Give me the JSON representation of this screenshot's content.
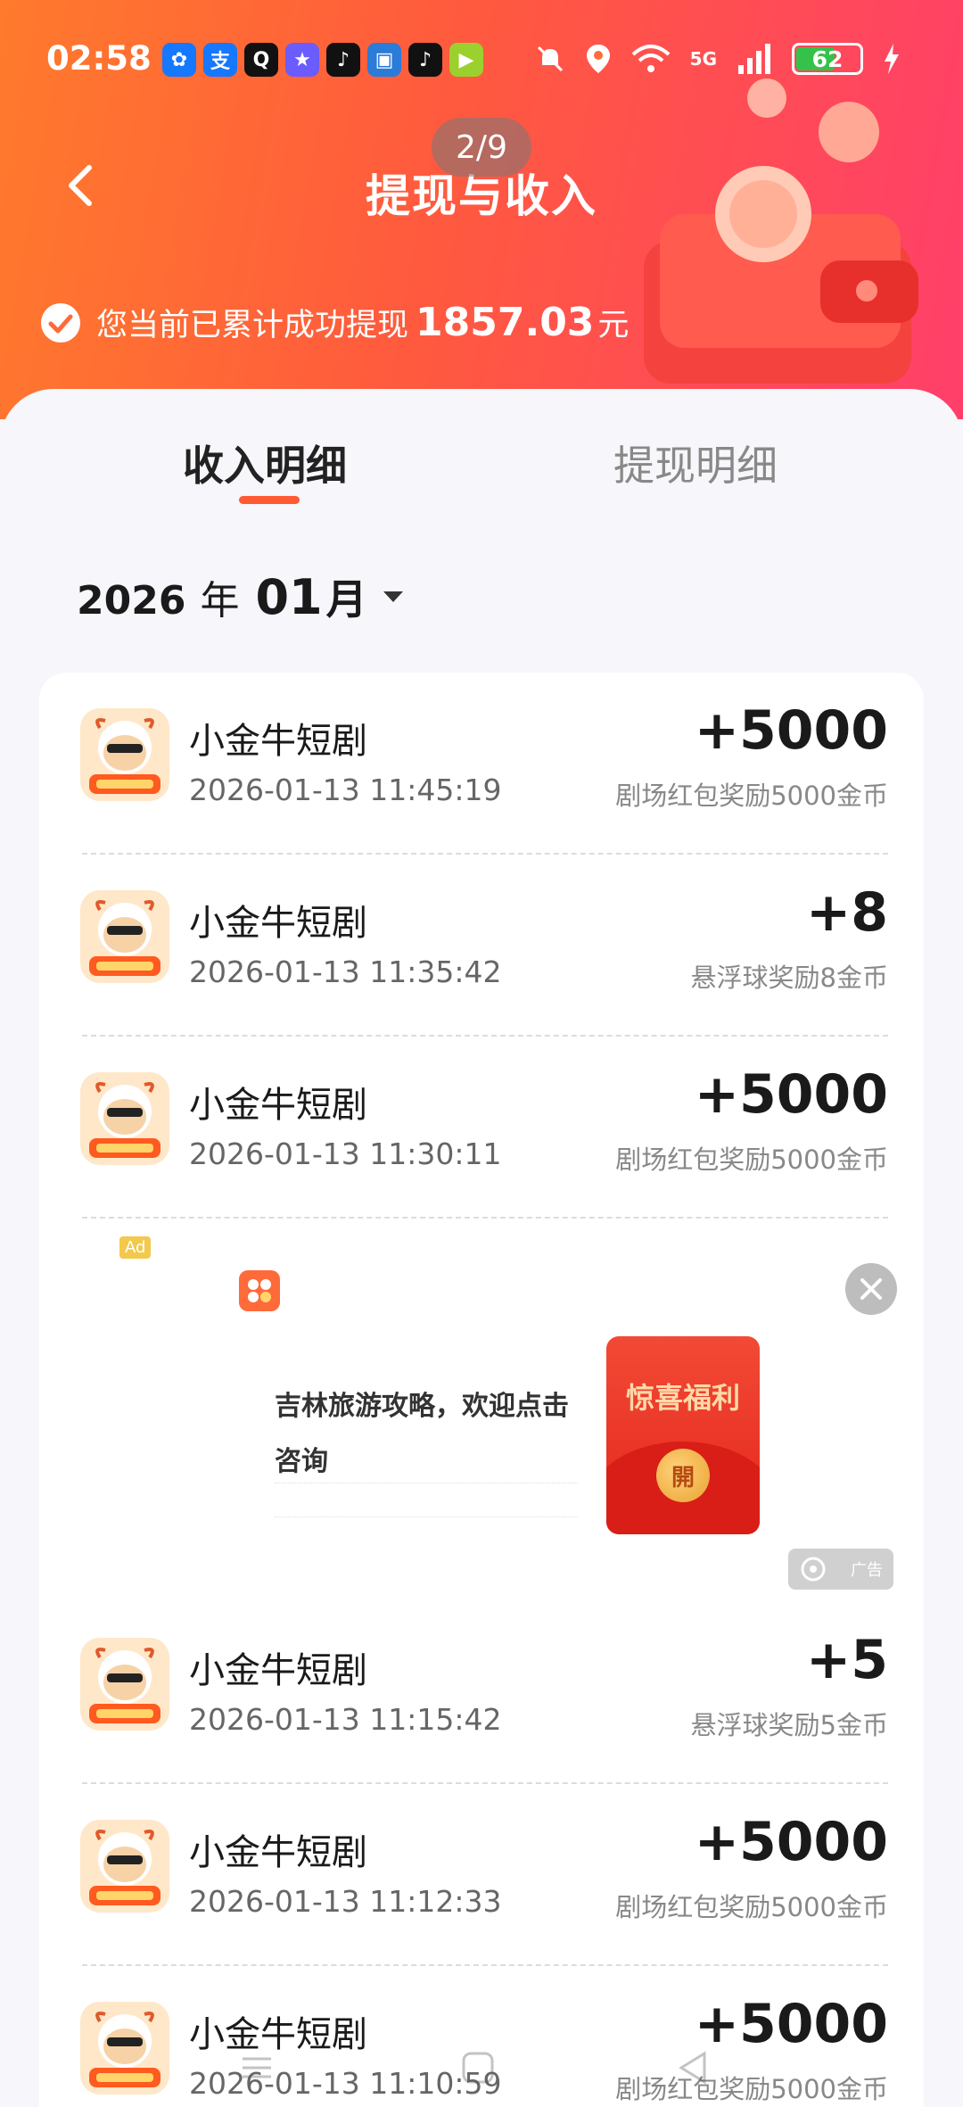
{
  "status_bar": {
    "time": "02:58",
    "app_icons": [
      {
        "name": "pinwheel-app-icon",
        "glyph": "✿",
        "color": "#1677ff"
      },
      {
        "name": "alipay-app-icon",
        "glyph": "支",
        "color": "#1677ff"
      },
      {
        "name": "qq-app-icon",
        "glyph": "Q",
        "color": "#111111"
      },
      {
        "name": "star-app-icon",
        "glyph": "★",
        "color": "#6a5cff"
      },
      {
        "name": "tiktok-app-icon",
        "glyph": "♪",
        "color": "#111111"
      },
      {
        "name": "bilibili-app-icon",
        "glyph": "▣",
        "color": "#2b7bd9"
      },
      {
        "name": "tiktok-lite-app-icon",
        "glyph": "♪",
        "color": "#111111"
      },
      {
        "name": "video-app-icon",
        "glyph": "▶",
        "color": "#9bd12e"
      }
    ],
    "network": "5G",
    "battery_level": 62
  },
  "page_counter": "2/9",
  "header": {
    "title": "提现与收入",
    "summary_prefix": "您当前已累计成功提现",
    "summary_amount": "1857.03",
    "summary_unit": "元"
  },
  "tabs": [
    {
      "label": "收入明细",
      "active": true
    },
    {
      "label": "提现明细",
      "active": false
    }
  ],
  "month_selector": {
    "year": "2026",
    "year_suffix": "年",
    "month": "01",
    "month_suffix": "月"
  },
  "income_rows": [
    {
      "name": "小金牛短剧",
      "time": "2026-01-13 11:45:19",
      "amount": "+5000",
      "desc": "剧场红包奖励5000金币"
    },
    {
      "name": "小金牛短剧",
      "time": "2026-01-13 11:35:42",
      "amount": "+8",
      "desc": "悬浮球奖励8金币"
    },
    {
      "name": "小金牛短剧",
      "time": "2026-01-13 11:30:11",
      "amount": "+5000",
      "desc": "剧场红包奖励5000金币"
    },
    {
      "name": "小金牛短剧",
      "time": "2026-01-13 11:15:42",
      "amount": "+5",
      "desc": "悬浮球奖励5金币"
    },
    {
      "name": "小金牛短剧",
      "time": "2026-01-13 11:12:33",
      "amount": "+5000",
      "desc": "剧场红包奖励5000金币"
    },
    {
      "name": "小金牛短剧",
      "time": "2026-01-13 11:10:59",
      "amount": "+5000",
      "desc": "剧场红包奖励5000金币"
    }
  ],
  "ad": {
    "badge": "Ad",
    "text": "吉林旅游攻略，欢迎点击咨询",
    "envelope_title": "惊喜福利",
    "envelope_button": "開",
    "tag": "广告"
  },
  "colors": {
    "accent": "#ff5a33",
    "header_start": "#ff7a2c",
    "header_end": "#ff3f6a"
  }
}
